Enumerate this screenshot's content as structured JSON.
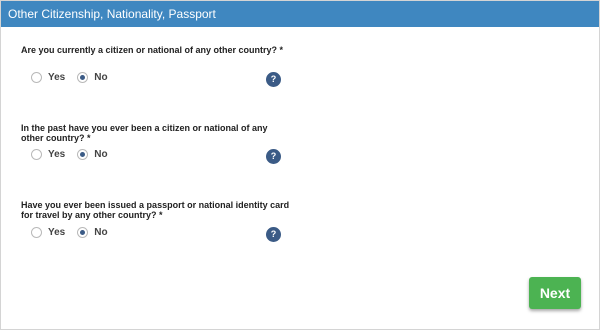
{
  "section": {
    "title": "Other Citizenship, Nationality, Passport"
  },
  "questions": [
    {
      "text": "Are you currently a citizen or national of any other country? *",
      "yes_label": "Yes",
      "no_label": "No",
      "selected": "No",
      "help_label": "?"
    },
    {
      "text": "In the past have you ever been a citizen or national of any other country? *",
      "yes_label": "Yes",
      "no_label": "No",
      "selected": "No",
      "help_label": "?"
    },
    {
      "text": "Have you ever been issued a passport or national identity card for travel by any other country? *",
      "yes_label": "Yes",
      "no_label": "No",
      "selected": "No",
      "help_label": "?"
    }
  ],
  "actions": {
    "next_label": "Next"
  },
  "colors": {
    "header_bg": "#3f87c0",
    "radio_selected": "#3b5b86",
    "help_bg": "#3b5b86",
    "next_bg": "#4cb352"
  }
}
